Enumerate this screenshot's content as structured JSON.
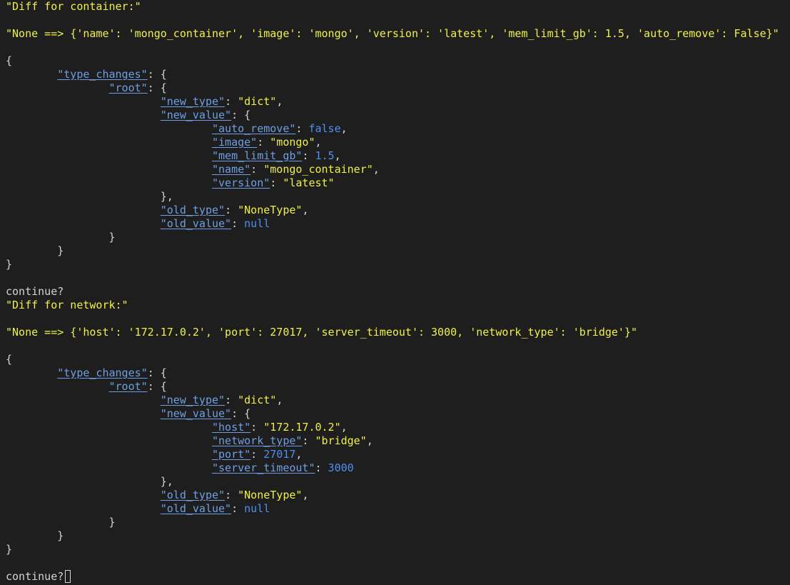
{
  "container": {
    "header": "\"Diff for container:\"",
    "summary": "\"None ==> {'name': 'mongo_container', 'image': 'mongo', 'version': 'latest', 'mem_limit_gb': 1.5, 'auto_remove': False}\"",
    "open_brace": "{",
    "type_changes_key": "\"type_changes\"",
    "root_key": "\"root\"",
    "new_type_key": "\"new_type\"",
    "new_type_value": "\"dict\"",
    "new_value_key": "\"new_value\"",
    "fields": [
      {
        "key": "\"auto_remove\"",
        "value": "false",
        "kind": "literal",
        "comma": ","
      },
      {
        "key": "\"image\"",
        "value": "\"mongo\"",
        "kind": "string",
        "comma": ","
      },
      {
        "key": "\"mem_limit_gb\"",
        "value": "1.5",
        "kind": "literal",
        "comma": ","
      },
      {
        "key": "\"name\"",
        "value": "\"mongo_container\"",
        "kind": "string",
        "comma": ","
      },
      {
        "key": "\"version\"",
        "value": "\"latest\"",
        "kind": "string",
        "comma": ""
      }
    ],
    "old_type_key": "\"old_type\"",
    "old_type_value": "\"NoneType\"",
    "old_value_key": "\"old_value\"",
    "old_value_value": "null"
  },
  "prompt1": "continue?",
  "network": {
    "header": "\"Diff for network:\"",
    "summary": "\"None ==> {'host': '172.17.0.2', 'port': 27017, 'server_timeout': 3000, 'network_type': 'bridge'}\"",
    "open_brace": "{",
    "type_changes_key": "\"type_changes\"",
    "root_key": "\"root\"",
    "new_type_key": "\"new_type\"",
    "new_type_value": "\"dict\"",
    "new_value_key": "\"new_value\"",
    "fields": [
      {
        "key": "\"host\"",
        "value": "\"172.17.0.2\"",
        "kind": "string",
        "comma": ","
      },
      {
        "key": "\"network_type\"",
        "value": "\"bridge\"",
        "kind": "string",
        "comma": ","
      },
      {
        "key": "\"port\"",
        "value": "27017",
        "kind": "literal",
        "comma": ","
      },
      {
        "key": "\"server_timeout\"",
        "value": "3000",
        "kind": "literal",
        "comma": ""
      }
    ],
    "old_type_key": "\"old_type\"",
    "old_type_value": "\"NoneType\"",
    "old_value_key": "\"old_value\"",
    "old_value_value": "null"
  },
  "prompt2": "continue?"
}
